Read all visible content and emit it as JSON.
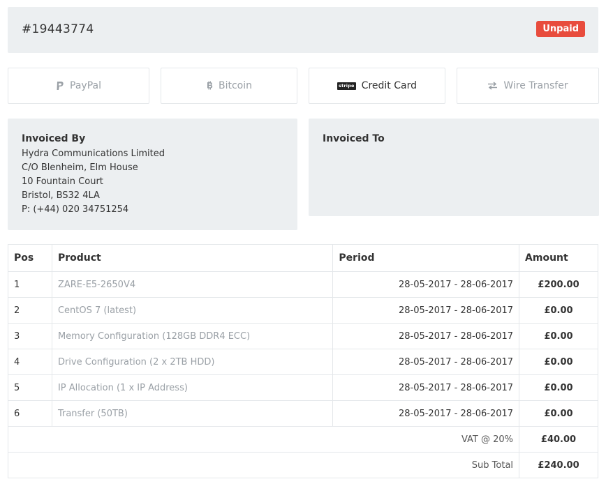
{
  "invoice": {
    "number": "#19443774",
    "status": "Unpaid",
    "status_color": "#e84c3d"
  },
  "payment_methods": [
    {
      "label": "PayPal",
      "icon": "paypal-icon"
    },
    {
      "label": "Bitcoin",
      "icon": "bitcoin-icon"
    },
    {
      "label": "Credit Card",
      "icon": "stripe-icon",
      "icon_text": "stripe",
      "active": true
    },
    {
      "label": "Wire Transfer",
      "icon": "transfer-arrows-icon"
    }
  ],
  "invoiced_by": {
    "title": "Invoiced By",
    "lines": [
      "Hydra Communications Limited",
      "C/O Blenheim, Elm House",
      "10 Fountain Court",
      "Bristol, BS32 4LA",
      "P: (+44) 020 34751254"
    ]
  },
  "invoiced_to": {
    "title": "Invoiced To"
  },
  "table": {
    "headers": [
      "Pos",
      "Product",
      "Period",
      "Amount"
    ],
    "rows": [
      {
        "pos": "1",
        "product": "ZARE-E5-2650V4",
        "period": "28-05-2017 - 28-06-2017",
        "amount": "£200.00"
      },
      {
        "pos": "2",
        "product": "CentOS 7 (latest)",
        "period": "28-05-2017 - 28-06-2017",
        "amount": "£0.00"
      },
      {
        "pos": "3",
        "product": "Memory Configuration (128GB DDR4 ECC)",
        "period": "28-05-2017 - 28-06-2017",
        "amount": "£0.00"
      },
      {
        "pos": "4",
        "product": "Drive Configuration (2 x 2TB HDD)",
        "period": "28-05-2017 - 28-06-2017",
        "amount": "£0.00"
      },
      {
        "pos": "5",
        "product": "IP Allocation (1 x IP Address)",
        "period": "28-05-2017 - 28-06-2017",
        "amount": "£0.00"
      },
      {
        "pos": "6",
        "product": "Transfer (50TB)",
        "period": "28-05-2017 - 28-06-2017",
        "amount": "£0.00"
      }
    ],
    "vat": {
      "label": "VAT @ 20%",
      "amount": "£40.00"
    },
    "subtotal": {
      "label": "Sub Total",
      "amount": "£240.00"
    }
  }
}
